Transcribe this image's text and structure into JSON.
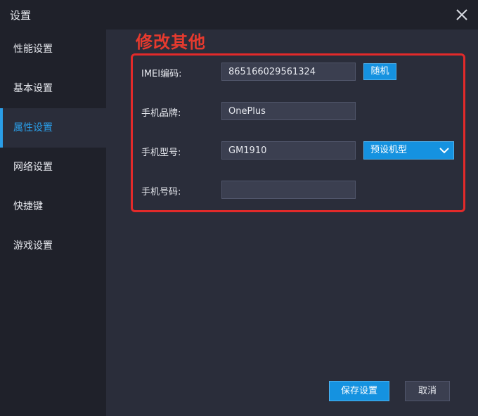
{
  "window": {
    "title": "设置",
    "close_icon": "close-icon"
  },
  "sidebar": {
    "items": [
      {
        "label": "性能设置",
        "active": false
      },
      {
        "label": "基本设置",
        "active": false
      },
      {
        "label": "属性设置",
        "active": true
      },
      {
        "label": "网络设置",
        "active": false
      },
      {
        "label": "快捷键",
        "active": false
      },
      {
        "label": "游戏设置",
        "active": false
      }
    ]
  },
  "annotation": {
    "text": "修改其他",
    "color": "#e63a2e"
  },
  "form": {
    "imei": {
      "label": "IMEI编码:",
      "value": "865166029561324"
    },
    "random_button": "随机",
    "brand": {
      "label": "手机品牌:",
      "value": "OnePlus"
    },
    "model": {
      "label": "手机型号:",
      "value": "GM1910"
    },
    "preset_select": {
      "selected": "预设机型"
    },
    "phone": {
      "label": "手机号码:",
      "value": ""
    }
  },
  "footer": {
    "save_label": "保存设置",
    "cancel_label": "取消"
  },
  "colors": {
    "accent": "#1592e0",
    "active_text": "#2a9ee8",
    "annotation_box": "#e22a2a"
  }
}
